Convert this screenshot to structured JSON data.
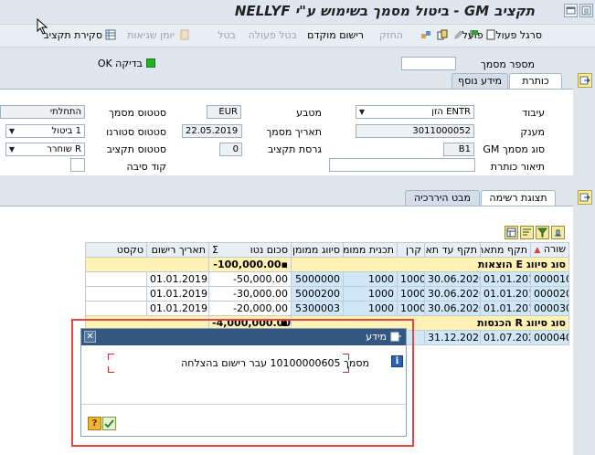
{
  "title": "תקציב GM - ביטול מסמך בשימוש ע\"י NELLYF",
  "toolbar": {
    "items": [
      {
        "label": "סרגל פעולות פועל",
        "enabled": true
      },
      {
        "label": "החזק",
        "enabled": false
      },
      {
        "label": "רישום מוקדם",
        "enabled": true
      },
      {
        "label": "בטל פעולה",
        "enabled": false
      },
      {
        "label": "בטל",
        "enabled": false
      },
      {
        "label": "יומן שגיאות",
        "enabled": false
      },
      {
        "label": "סקירת תקציב",
        "enabled": true
      }
    ]
  },
  "check": {
    "label": "בדיקה OK",
    "status_color": "#21b321"
  },
  "doc_number": {
    "label": "מספר מסמך",
    "value": ""
  },
  "tabs_header": [
    {
      "label": "כותרת",
      "active": true
    },
    {
      "label": "מידע נוסף",
      "active": false
    }
  ],
  "header_fields": {
    "processing": {
      "label": "עיבוד",
      "value": "ENTR הזן"
    },
    "grantor": {
      "label": "מענק",
      "value": "3011000052"
    },
    "gm_doc_type": {
      "label": "סוג מסמך GM",
      "value": "B1"
    },
    "header_desc": {
      "label": "תיאור כותרת",
      "value": ""
    },
    "currency": {
      "label": "מטבע",
      "value": "EUR"
    },
    "doc_date": {
      "label": "תאריך מסמך",
      "value": "22.05.2019"
    },
    "budget_version": {
      "label": "גרסת תקציב",
      "value": "0"
    },
    "doc_status": {
      "label": "סטטוס מסמך",
      "value": "התחלתי"
    },
    "reversal_status": {
      "label": "סטטוס סטורנו",
      "value": "1 ביטול"
    },
    "budget_status": {
      "label": "סטטוס תקציב",
      "value": "R שוחרר"
    },
    "reason_code": {
      "label": "קוד סיבה",
      "value": ""
    }
  },
  "tabs_items": [
    {
      "label": "תצוגת רשימה",
      "active": true
    },
    {
      "label": "מבט היררכיה",
      "active": false
    }
  ],
  "grid": {
    "columns": [
      "שורה",
      "תקף מתאריך",
      "תקף עד תאריך",
      "קרן",
      "תכנית ממומנת",
      "סיווג ממומן",
      "סכום נטו",
      "תאריך רישום",
      "טקסט"
    ],
    "sort_badge": "Σ",
    "rows": [
      {
        "kind": "group",
        "label": "סוג סיווג E הוצאות",
        "amount": "-100,000.00",
        "marker": "▪"
      },
      {
        "kind": "item",
        "line": "000010",
        "from": "01.01.2019",
        "to": "30.06.2020",
        "fund": "1000",
        "program": "1000",
        "sponsored": "5000000",
        "amount": "-50,000.00",
        "posting": "01.01.2019",
        "text": ""
      },
      {
        "kind": "item",
        "line": "000020",
        "from": "01.01.2019",
        "to": "30.06.2020",
        "fund": "1000",
        "program": "1000",
        "sponsored": "5000200",
        "amount": "-30,000.00",
        "posting": "01.01.2019",
        "text": ""
      },
      {
        "kind": "item",
        "line": "000030",
        "from": "01.01.2019",
        "to": "30.06.2020",
        "fund": "1000",
        "program": "1000",
        "sponsored": "5300003",
        "amount": "-20,000.00",
        "posting": "01.01.2019",
        "text": ""
      },
      {
        "kind": "group",
        "label": "סוג סיווג R הכנסות",
        "amount": "-4,000,000.00",
        "marker": "▪"
      },
      {
        "kind": "item",
        "line": "000040",
        "from": "01.07.2020",
        "to": "31.12.2021",
        "fund": "",
        "program": "",
        "sponsored": "",
        "amount": "",
        "posting": "",
        "text": ""
      }
    ]
  },
  "dialog": {
    "title": "מידע",
    "message": "מסמך 10100000605 עבר רישום בהצלחה",
    "icon": "info-icon",
    "help_icon": "help-icon",
    "ok_icon": "checkmark-icon",
    "close_icon": "close-icon"
  },
  "colors": {
    "highlight_frame": "#e24646",
    "dialog_header": "#33577f",
    "group_row": "#fff2b3",
    "account_cell": "#cfe7f7"
  }
}
